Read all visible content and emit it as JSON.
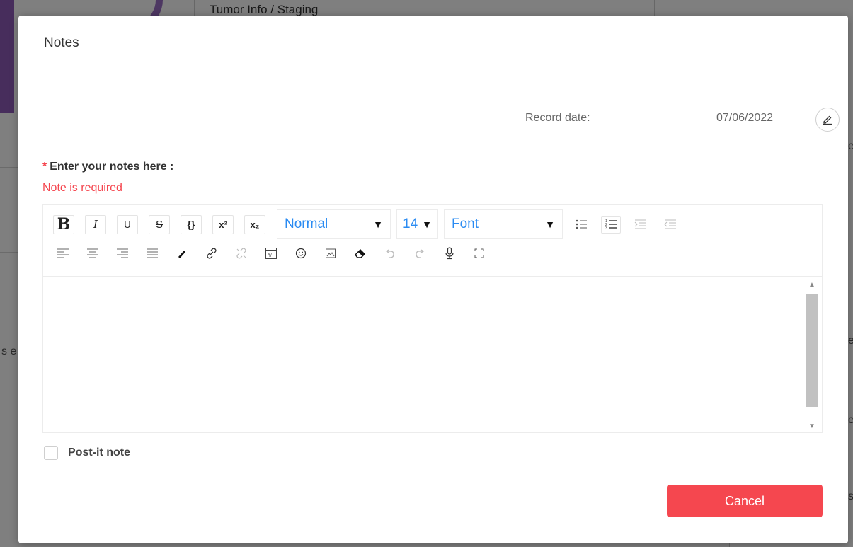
{
  "background": {
    "heading": "Tumor Info / Staging",
    "fragment_left": "s e",
    "fragment_right": [
      "e",
      "e",
      "e",
      "s"
    ]
  },
  "modal": {
    "title": "Notes",
    "record_date_label": "Record date:",
    "record_date_value": "07/06/2022",
    "notes_required_mark": "*",
    "notes_label": "Enter your notes here :",
    "notes_error": "Note is required",
    "toolbar": {
      "bold": "B",
      "italic": "I",
      "underline": "U",
      "strike": "S",
      "code": "{}",
      "superscript": "x²",
      "subscript": "x₂",
      "format_select": "Normal",
      "size_select": "14",
      "font_select": "Font"
    },
    "postit_label": "Post-it note",
    "cancel_label": "Cancel"
  },
  "colors": {
    "accent_red": "#f5474f",
    "link_blue": "#2a8bf2",
    "purple": "#8e5bb8"
  },
  "icons": [
    "pencil-icon",
    "bullet-list-icon",
    "numbered-list-icon",
    "indent-icon",
    "outdent-icon",
    "align-left-icon",
    "align-center-icon",
    "align-right-icon",
    "align-justify-icon",
    "color-picker-icon",
    "link-icon",
    "unlink-icon",
    "embed-icon",
    "emoji-icon",
    "image-icon",
    "eraser-icon",
    "undo-icon",
    "redo-icon",
    "microphone-icon",
    "fullscreen-icon"
  ]
}
